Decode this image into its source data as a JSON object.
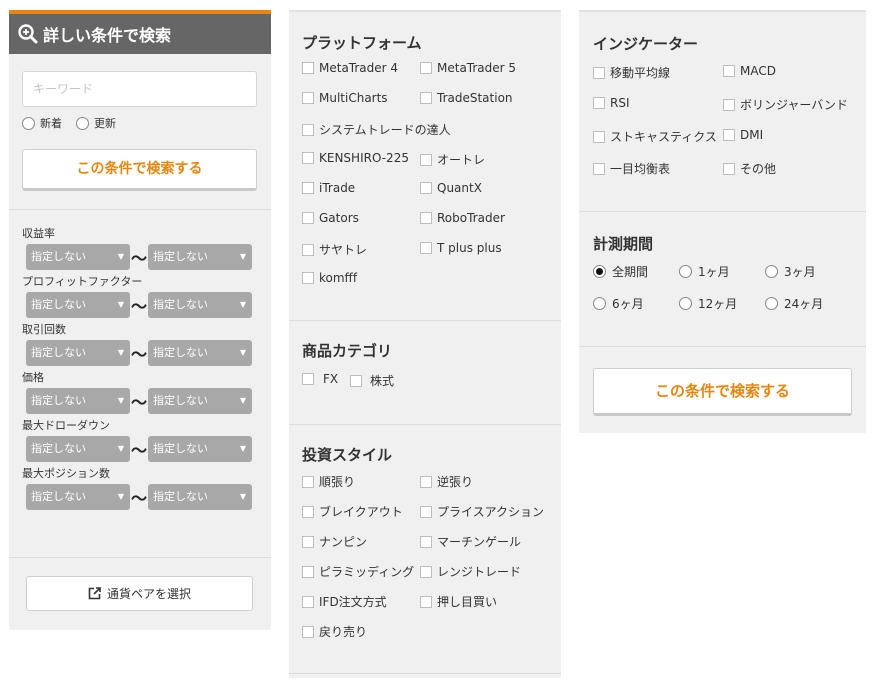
{
  "left": {
    "title": "詳しい条件で検索",
    "keyword_placeholder": "キーワード",
    "sort": [
      "新着",
      "更新"
    ],
    "search_button": "この条件で検索する",
    "ranges": [
      {
        "label": "収益率",
        "from": "指定しない",
        "to": "指定しない"
      },
      {
        "label": "プロフィットファクター",
        "from": "指定しない",
        "to": "指定しない"
      },
      {
        "label": "取引回数",
        "from": "指定しない",
        "to": "指定しない"
      },
      {
        "label": "価格",
        "from": "指定しない",
        "to": "指定しない"
      },
      {
        "label": "最大ドローダウン",
        "from": "指定しない",
        "to": "指定しない"
      },
      {
        "label": "最大ポジション数",
        "from": "指定しない",
        "to": "指定しない"
      }
    ],
    "tilde": "〜",
    "pair_button": "通貨ペアを選択"
  },
  "platform": {
    "title": "プラットフォーム",
    "items": [
      "MetaTrader 4",
      "MetaTrader 5",
      "MultiCharts",
      "TradeStation",
      "システムトレードの達人",
      "KENSHIRO-225",
      "オートレ",
      "iTrade",
      "QuantX",
      "Gators",
      "RoboTrader",
      "サヤトレ",
      "T plus plus",
      "komfff"
    ]
  },
  "category": {
    "title": "商品カテゴリ",
    "items": [
      "FX",
      "株式"
    ]
  },
  "style": {
    "title": "投資スタイル",
    "items": [
      "順張り",
      "逆張り",
      "ブレイクアウト",
      "プライスアクション",
      "ナンピン",
      "マーチンゲール",
      "ピラミッディング",
      "レンジトレード",
      "IFD注文方式",
      "押し目買い",
      "戻り売り"
    ]
  },
  "indicator": {
    "title": "インジケーター",
    "items": [
      "移動平均線",
      "MACD",
      "RSI",
      "ボリンジャーバンド",
      "ストキャスティクス",
      "DMI",
      "一目均衡表",
      "その他"
    ]
  },
  "period": {
    "title": "計測期間",
    "options": [
      "全期間",
      "1ヶ月",
      "3ヶ月",
      "6ヶ月",
      "12ヶ月",
      "24ヶ月"
    ],
    "selected": "全期間"
  },
  "right_search_button": "この条件で検索する"
}
